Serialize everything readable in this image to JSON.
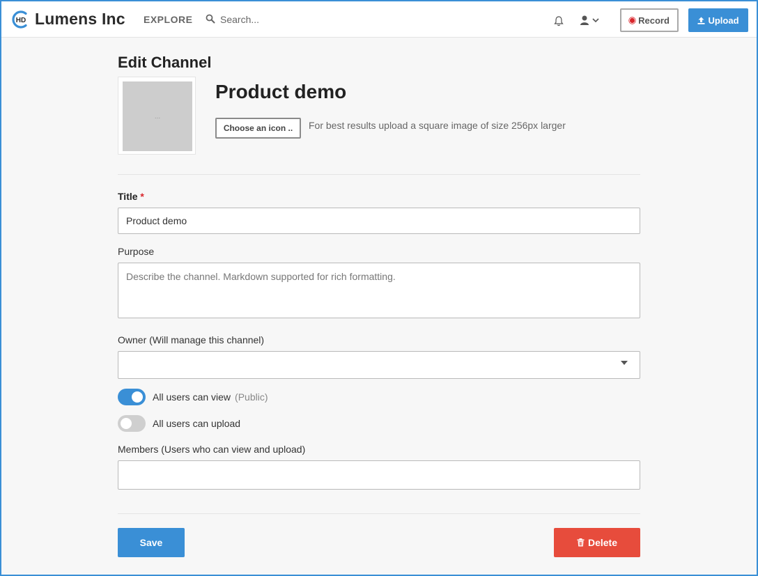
{
  "header": {
    "brand": "Lumens Inc",
    "logo_text": "HD",
    "explore_label": "EXPLORE",
    "search_placeholder": "Search...",
    "record_label": "Record",
    "upload_label": "Upload",
    "accent_color": "#3a8fd6",
    "icons": [
      "hd-logo-icon",
      "search-icon",
      "bell-icon",
      "user-icon",
      "chevron-down-icon",
      "record-dot-icon",
      "upload-icon"
    ]
  },
  "page": {
    "title": "Edit Channel",
    "channel_name": "Product demo",
    "icon_placeholder_text": "...",
    "choose_icon_label": "Choose an icon ..",
    "icon_hint": "For best results upload a square image of size 256px larger"
  },
  "form": {
    "title_label": "Title",
    "title_required_mark": "*",
    "title_value": "Product demo",
    "purpose_label": "Purpose",
    "purpose_placeholder": "Describe the channel. Markdown supported for rich formatting.",
    "purpose_value": "",
    "owner_label": "Owner (Will manage this channel)",
    "owner_value": "",
    "public_toggle_label": "All users can view",
    "public_toggle_note": "(Public)",
    "public_toggle_on": true,
    "upload_toggle_label": "All users can upload",
    "upload_toggle_on": false,
    "members_label": "Members (Users who can view and upload)",
    "members_value": ""
  },
  "actions": {
    "save_label": "Save",
    "delete_label": "Delete",
    "delete_color": "#e74c3c"
  }
}
